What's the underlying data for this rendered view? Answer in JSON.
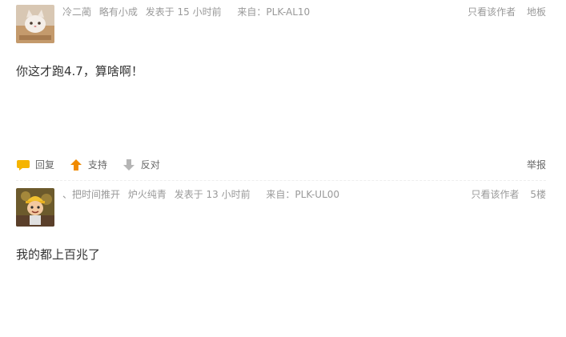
{
  "posts": [
    {
      "author": "冷二蔺",
      "rank": "略有小成",
      "posted": "发表于 15 小时前",
      "source": "来自：PLK-AL10",
      "only_author": "只看该作者",
      "floor": "地板",
      "content": "你这才跑4.7，算啥啊！",
      "actions": {
        "reply": "回复",
        "support": "支持",
        "oppose": "反对",
        "report": "举报"
      }
    },
    {
      "author": "、把时间推开",
      "rank": "炉火纯青",
      "posted": "发表于 13 小时前",
      "source": "来自：PLK-UL00",
      "only_author": "只看该作者",
      "floor": "5楼",
      "content": "我的都上百兆了"
    }
  ],
  "colors": {
    "meta_text": "#999999",
    "content_text": "#333333",
    "reply_icon": "#f5b400",
    "support_icon": "#f08a00",
    "oppose_icon": "#b5b5b5"
  },
  "icons": {
    "avatar1": "cat-photo-avatar",
    "avatar2": "cartoon-boy-avatar",
    "reply": "speech-bubble-icon",
    "support": "arrow-up-icon",
    "oppose": "arrow-down-icon"
  }
}
